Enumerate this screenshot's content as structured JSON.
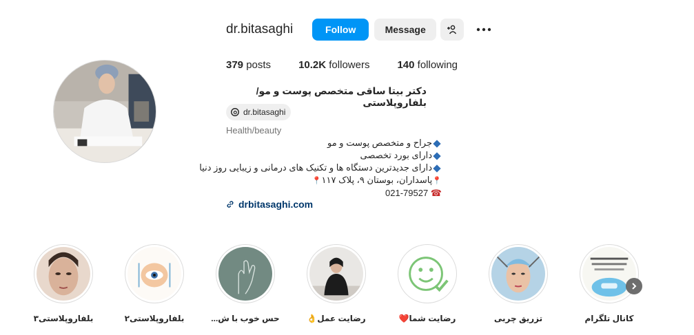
{
  "header": {
    "username": "dr.bitasaghi",
    "follow_label": "Follow",
    "message_label": "Message"
  },
  "stats": {
    "posts_count": "379",
    "posts_label": "posts",
    "followers_count": "10.2K",
    "followers_label": "followers",
    "following_count": "140",
    "following_label": "following"
  },
  "profile": {
    "full_name": "دکتر بیتا ساقی متخصص پوست و مو/بلفاروپلاستی",
    "threads_handle": "dr.bitasaghi",
    "category": "Health/beauty",
    "bio_lines": [
      "جراح و متخصص پوست و مو",
      "دارای بورد تخصصی",
      "دارای جدیدترین دستگاه ها و تکنیک های درمانی و زیبایی روز دنیا",
      "پاسداران، بوستان ۹، پلاک ۱۱۷",
      "021-79527"
    ],
    "website": "drbitasaghi.com"
  },
  "highlights": [
    {
      "label": "بلفاروپلاستی۳",
      "icon": "face-photo"
    },
    {
      "label": "بلفاروپلاستی۲",
      "icon": "eye-illustration"
    },
    {
      "label": "حس خوب با ش...",
      "icon": "hand-line-art"
    },
    {
      "label": "رضایت عمل👌",
      "icon": "patient-photo"
    },
    {
      "label": "رضایت شما❤️",
      "icon": "smiley-check"
    },
    {
      "label": "تزریق چربی",
      "icon": "face-treatment"
    },
    {
      "label": "کانال تلگرام",
      "icon": "telegram-flyer"
    }
  ],
  "colors": {
    "follow_button": "#0095f6",
    "link_text": "#00376b",
    "diamond": "#2d6db5"
  }
}
